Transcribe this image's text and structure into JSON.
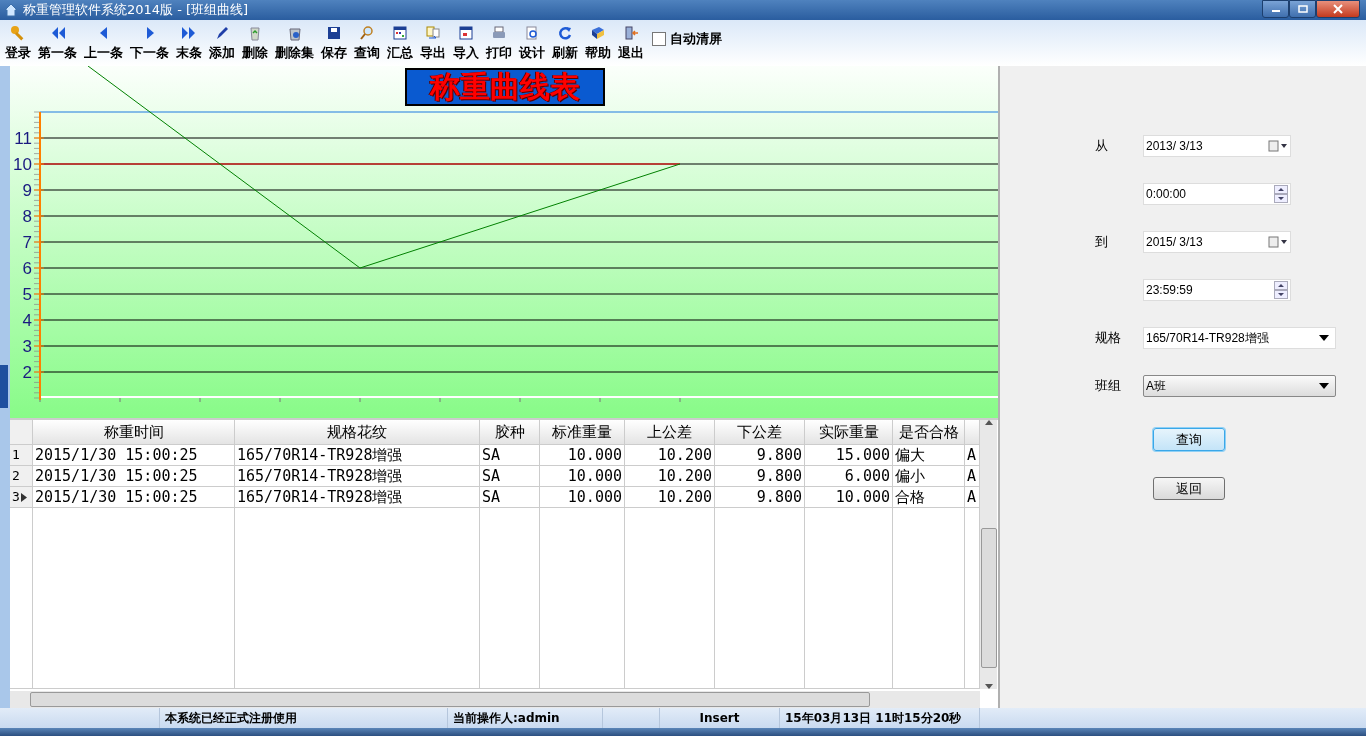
{
  "window": {
    "title": "称重管理软件系统2014版 - [班组曲线]"
  },
  "toolbar": {
    "buttons": [
      {
        "label": "登录"
      },
      {
        "label": "第一条"
      },
      {
        "label": "上一条"
      },
      {
        "label": "下一条"
      },
      {
        "label": "末条"
      },
      {
        "label": "添加"
      },
      {
        "label": "删除"
      },
      {
        "label": "删除集"
      },
      {
        "label": "保存"
      },
      {
        "label": "查询"
      },
      {
        "label": "汇总"
      },
      {
        "label": "导出"
      },
      {
        "label": "导入"
      },
      {
        "label": "打印"
      },
      {
        "label": "设计"
      },
      {
        "label": "刷新"
      },
      {
        "label": "帮助"
      },
      {
        "label": "退出"
      }
    ],
    "checkbox": {
      "label": "自动清屏",
      "checked": false
    }
  },
  "chart": {
    "title": "称重曲线表",
    "y_labels": [
      "11",
      "10",
      "9",
      "8",
      "7",
      "6",
      "5",
      "4",
      "3",
      "2"
    ]
  },
  "grid": {
    "columns": [
      "称重时间",
      "规格花纹",
      "胶种",
      "标准重量",
      "上公差",
      "下公差",
      "实际重量",
      "是否合格"
    ],
    "rows": [
      {
        "number": "1",
        "current": false,
        "cells": [
          "2015/1/30 15:00:25",
          "165/70R14-TR928增强",
          "SA",
          "10.000",
          "10.200",
          "9.800",
          "15.000",
          "偏大",
          "A"
        ]
      },
      {
        "number": "2",
        "current": false,
        "cells": [
          "2015/1/30 15:00:25",
          "165/70R14-TR928增强",
          "SA",
          "10.000",
          "10.200",
          "9.800",
          "6.000",
          "偏小",
          "A"
        ]
      },
      {
        "number": "3",
        "current": true,
        "cells": [
          "2015/1/30 15:00:25",
          "165/70R14-TR928增强",
          "SA",
          "10.000",
          "10.200",
          "9.800",
          "10.000",
          "合格",
          "A"
        ]
      }
    ]
  },
  "filters": [
    {
      "label": "从",
      "kind": "date",
      "value": "2013/  3/13"
    },
    {
      "kind": "time",
      "value": "0:00:00"
    },
    {
      "label": "到",
      "kind": "date",
      "value": "2015/  3/13"
    },
    {
      "kind": "time",
      "value": "23:59:59"
    },
    {
      "label": "规格",
      "kind": "combo",
      "value": "165/70R14-TR928增强"
    },
    {
      "label": "班组",
      "kind": "dropdown",
      "value": "A班"
    }
  ],
  "buttons": [
    {
      "label": "查询",
      "focused": true
    },
    {
      "label": "返回",
      "focused": false
    }
  ],
  "status_bar": [
    "本系统已经正式注册使用",
    "当前操作人:admin",
    "Insert",
    "15年03月13日  11时15分20秒"
  ]
}
